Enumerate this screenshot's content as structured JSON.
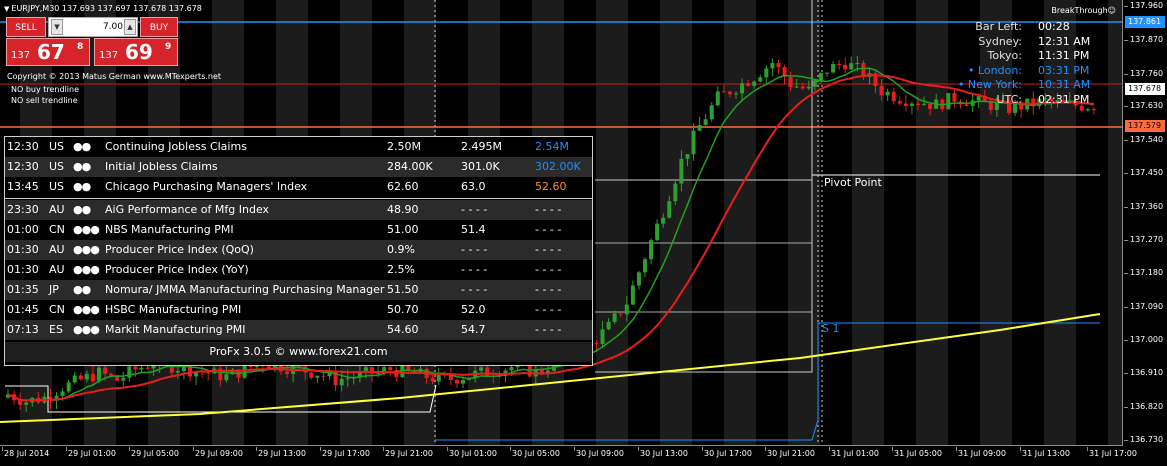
{
  "symbol_header": "EURJPY,M30  137.693 137.697 137.678 137.678",
  "trade_panel": {
    "sell_label": "SELL",
    "buy_label": "BUY",
    "lot_value": "7.00",
    "sell_price": {
      "prefix": "137",
      "big": "67",
      "sup": "8"
    },
    "buy_price": {
      "prefix": "137",
      "big": "69",
      "sup": "9"
    }
  },
  "copyright": "Copyright © 2013 Matus German www.MTexperts.net",
  "no_buy": "NO buy trendline",
  "no_sell": "NO sell trendline",
  "breakthrough": "BreakThrough☺",
  "info": [
    {
      "label": "Bar Left:",
      "value": "00:28",
      "color": "#e0e0e0",
      "valcolor": "#ffffff"
    },
    {
      "label": "Sydney:",
      "value": "12:31 AM",
      "color": "#e0e0e0",
      "valcolor": "#ffffff"
    },
    {
      "label": "Tokyo:",
      "value": "11:31 PM",
      "color": "#e0e0e0",
      "valcolor": "#ffffff"
    },
    {
      "label": "• London:",
      "value": "03:31 PM",
      "color": "#1e90ff",
      "valcolor": "#1e90ff"
    },
    {
      "label": "• New York:",
      "value": "10:31 AM",
      "color": "#1e90ff",
      "valcolor": "#1e90ff"
    },
    {
      "label": "UTC:",
      "value": "02:31 PM",
      "color": "#e0e0e0",
      "valcolor": "#ffffff"
    }
  ],
  "news": [
    {
      "time": "12:30",
      "cur": "US",
      "imp": "●●",
      "title": "Continuing Jobless Claims",
      "actual": "2.50M",
      "forecast": "2.495M",
      "previous": "2.54M",
      "prevcolor": "#1e90ff"
    },
    {
      "time": "12:30",
      "cur": "US",
      "imp": "●●",
      "title": "Initial Jobless Claims",
      "actual": "284.00K",
      "forecast": "301.0K",
      "previous": "302.00K",
      "prevcolor": "#1e90ff"
    },
    {
      "time": "13:45",
      "cur": "US",
      "imp": "●●",
      "title": "Chicago Purchasing Managers' Index",
      "actual": "62.60",
      "forecast": "63.0",
      "previous": "52.60",
      "prevcolor": "#ff8c1a"
    },
    {
      "time": "23:30",
      "cur": "AU",
      "imp": "●●",
      "title": "AiG Performance of Mfg Index",
      "actual": "48.90",
      "forecast": "- - - -",
      "previous": "- - - -",
      "prevcolor": "#ffffff"
    },
    {
      "time": "01:00",
      "cur": "CN",
      "imp": "●●●",
      "title": "NBS Manufacturing PMI",
      "actual": "51.00",
      "forecast": "51.4",
      "previous": "- - - -",
      "prevcolor": "#ffffff"
    },
    {
      "time": "01:30",
      "cur": "AU",
      "imp": "●●●",
      "title": "Producer Price Index (QoQ)",
      "actual": "0.9%",
      "forecast": "- - - -",
      "previous": "- - - -",
      "prevcolor": "#ffffff"
    },
    {
      "time": "01:30",
      "cur": "AU",
      "imp": "●●●",
      "title": "Producer Price Index (YoY)",
      "actual": "2.5%",
      "forecast": "- - - -",
      "previous": "- - - -",
      "prevcolor": "#ffffff"
    },
    {
      "time": "01:35",
      "cur": "JP",
      "imp": "●●",
      "title": "Nomura/ JMMA Manufacturing Purchasing Manager",
      "actual": "51.50",
      "forecast": "- - - -",
      "previous": "- - - -",
      "prevcolor": "#ffffff"
    },
    {
      "time": "01:45",
      "cur": "CN",
      "imp": "●●●",
      "title": "HSBC Manufacturing PMI",
      "actual": "50.70",
      "forecast": "52.0",
      "previous": "- - - -",
      "prevcolor": "#ffffff"
    },
    {
      "time": "07:13",
      "cur": "ES",
      "imp": "●●●",
      "title": "Markit Manufacturing PMI",
      "actual": "54.60",
      "forecast": "54.7",
      "previous": "- - - -",
      "prevcolor": "#ffffff"
    }
  ],
  "news_footer": "ProFx 3.0.5 © www.forex21.com",
  "pivot_label": "Pivot Point",
  "s1_label": "S 1",
  "price_labels": [
    "137.960",
    "137.870",
    "137.760",
    "137.630",
    "137.540",
    "137.450",
    "137.360",
    "137.270",
    "137.180",
    "137.090",
    "137.000",
    "136.910",
    "136.820",
    "136.730"
  ],
  "price_badges": [
    {
      "text": "137.861",
      "bg": "#1e90ff",
      "fg": "#ffffff"
    },
    {
      "text": "137.678",
      "bg": "#ffffff",
      "fg": "#000000"
    },
    {
      "text": "137.579",
      "bg": "#ff6a3d",
      "fg": "#000000"
    }
  ],
  "time_labels": [
    "28 Jul 2014",
    "29 Jul 01:00",
    "29 Jul 05:00",
    "29 Jul 09:00",
    "29 Jul 13:00",
    "29 Jul 17:00",
    "29 Jul 21:00",
    "30 Jul 01:00",
    "30 Jul 05:00",
    "30 Jul 09:00",
    "30 Jul 13:00",
    "30 Jul 17:00",
    "30 Jul 21:00",
    "31 Jul 01:00",
    "31 Jul 05:00",
    "31 Jul 09:00",
    "31 Jul 13:00",
    "31 Jul 17:00"
  ],
  "colors": {
    "up": "#2e9e2e",
    "down": "#e81e1e",
    "ma_fast": "#1fa31f",
    "ma_slow": "#e61e1e",
    "ma_long": "#ffff33",
    "pivot_blue": "#1e90ff",
    "resistance": "#e63a1e"
  },
  "chart_data": {
    "type": "candlestick",
    "title": "EURJPY,M30",
    "ylim": [
      136.73,
      137.97
    ],
    "close_approx": [
      136.86,
      136.84,
      136.85,
      136.88,
      136.9,
      136.92,
      136.9,
      136.93,
      136.95,
      136.94,
      136.93,
      136.92,
      136.91,
      136.93,
      136.95,
      136.94,
      136.93,
      136.92,
      136.9,
      136.91,
      136.92,
      136.93,
      136.92,
      136.91,
      136.9,
      136.91,
      136.92,
      136.93,
      136.94,
      136.92,
      136.95,
      136.98,
      137.0,
      137.05,
      137.12,
      137.25,
      137.38,
      137.52,
      137.62,
      137.7,
      137.73,
      137.76,
      137.8,
      137.74,
      137.72,
      137.78,
      137.8,
      137.77,
      137.72,
      137.7,
      137.69,
      137.68,
      137.7,
      137.69,
      137.68,
      137.67,
      137.68,
      137.69,
      137.68,
      137.678
    ]
  }
}
